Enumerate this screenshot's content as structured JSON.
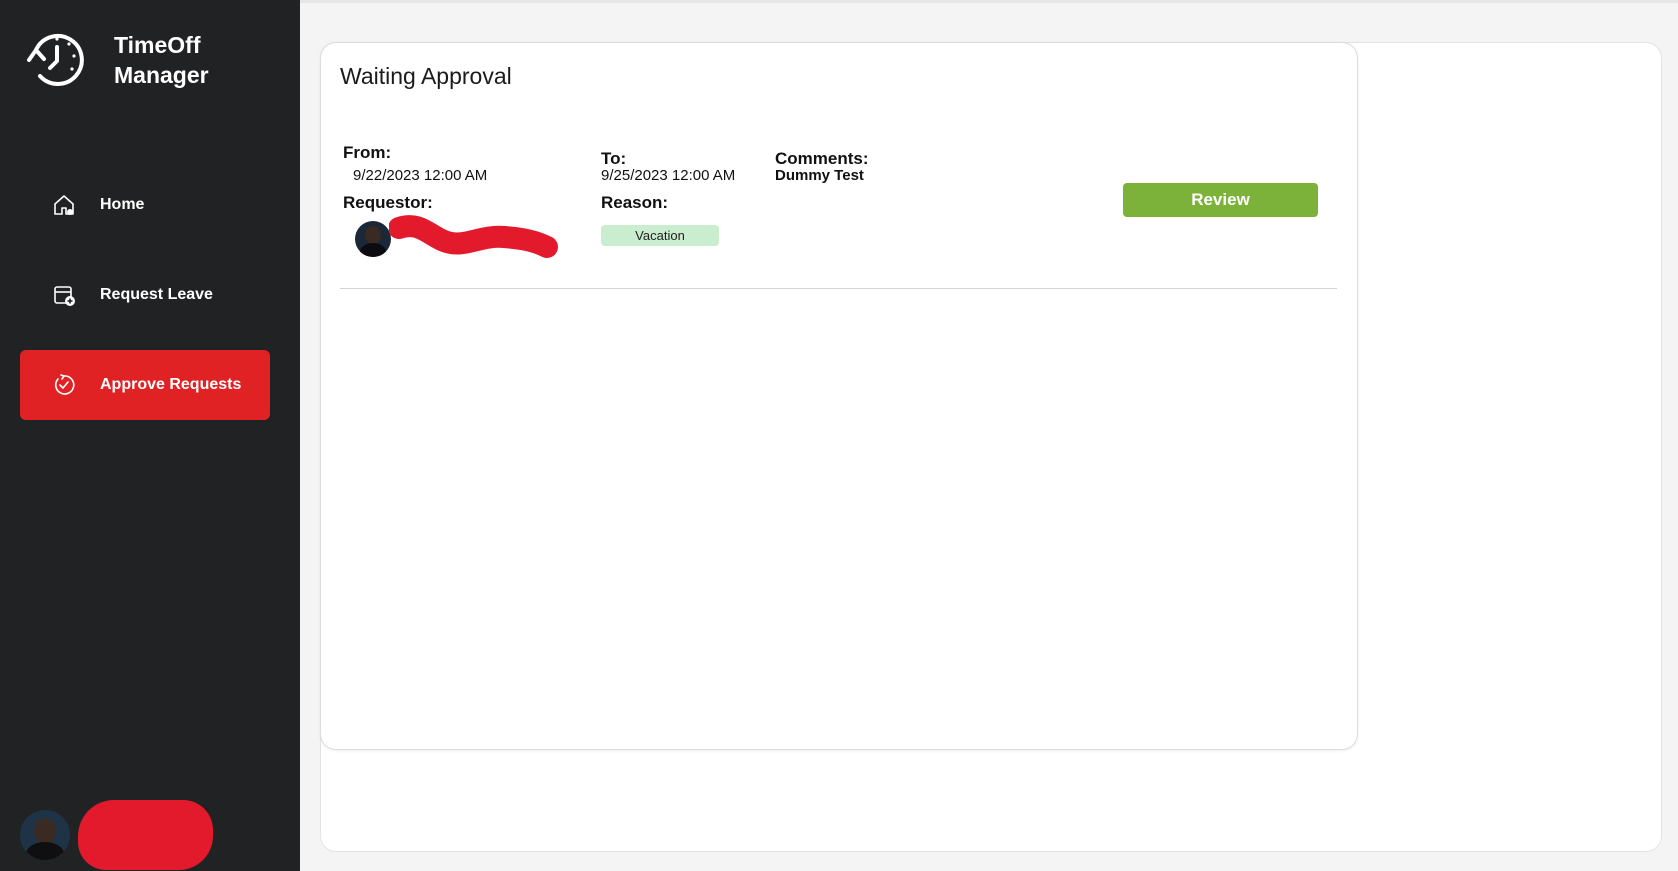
{
  "app": {
    "title": "TimeOff Manager",
    "title_line1": "TimeOff",
    "title_line2": "Manager"
  },
  "sidebar": {
    "items": [
      {
        "label": "Home",
        "icon": "home-icon",
        "active": false
      },
      {
        "label": "Request Leave",
        "icon": "calendar-add-icon",
        "active": false
      },
      {
        "label": "Approve Requests",
        "icon": "refresh-check-icon",
        "active": true
      }
    ],
    "active_color": "#e02224"
  },
  "main": {
    "card_title": "Waiting Approval",
    "request": {
      "from_label": "From:",
      "from_value": "9/22/2023 12:00 AM",
      "to_label": "To:",
      "to_value": "9/25/2023 12:00 AM",
      "comments_label": "Comments:",
      "comments_value": "Dummy Test",
      "requestor_label": "Requestor:",
      "reason_label": "Reason:",
      "reason_value": "Vacation",
      "review_label": "Review"
    }
  },
  "colors": {
    "sidebar_bg": "#212224",
    "review_button": "#7cb13a",
    "reason_badge": "#c9edce",
    "redaction": "#e21a2c"
  }
}
